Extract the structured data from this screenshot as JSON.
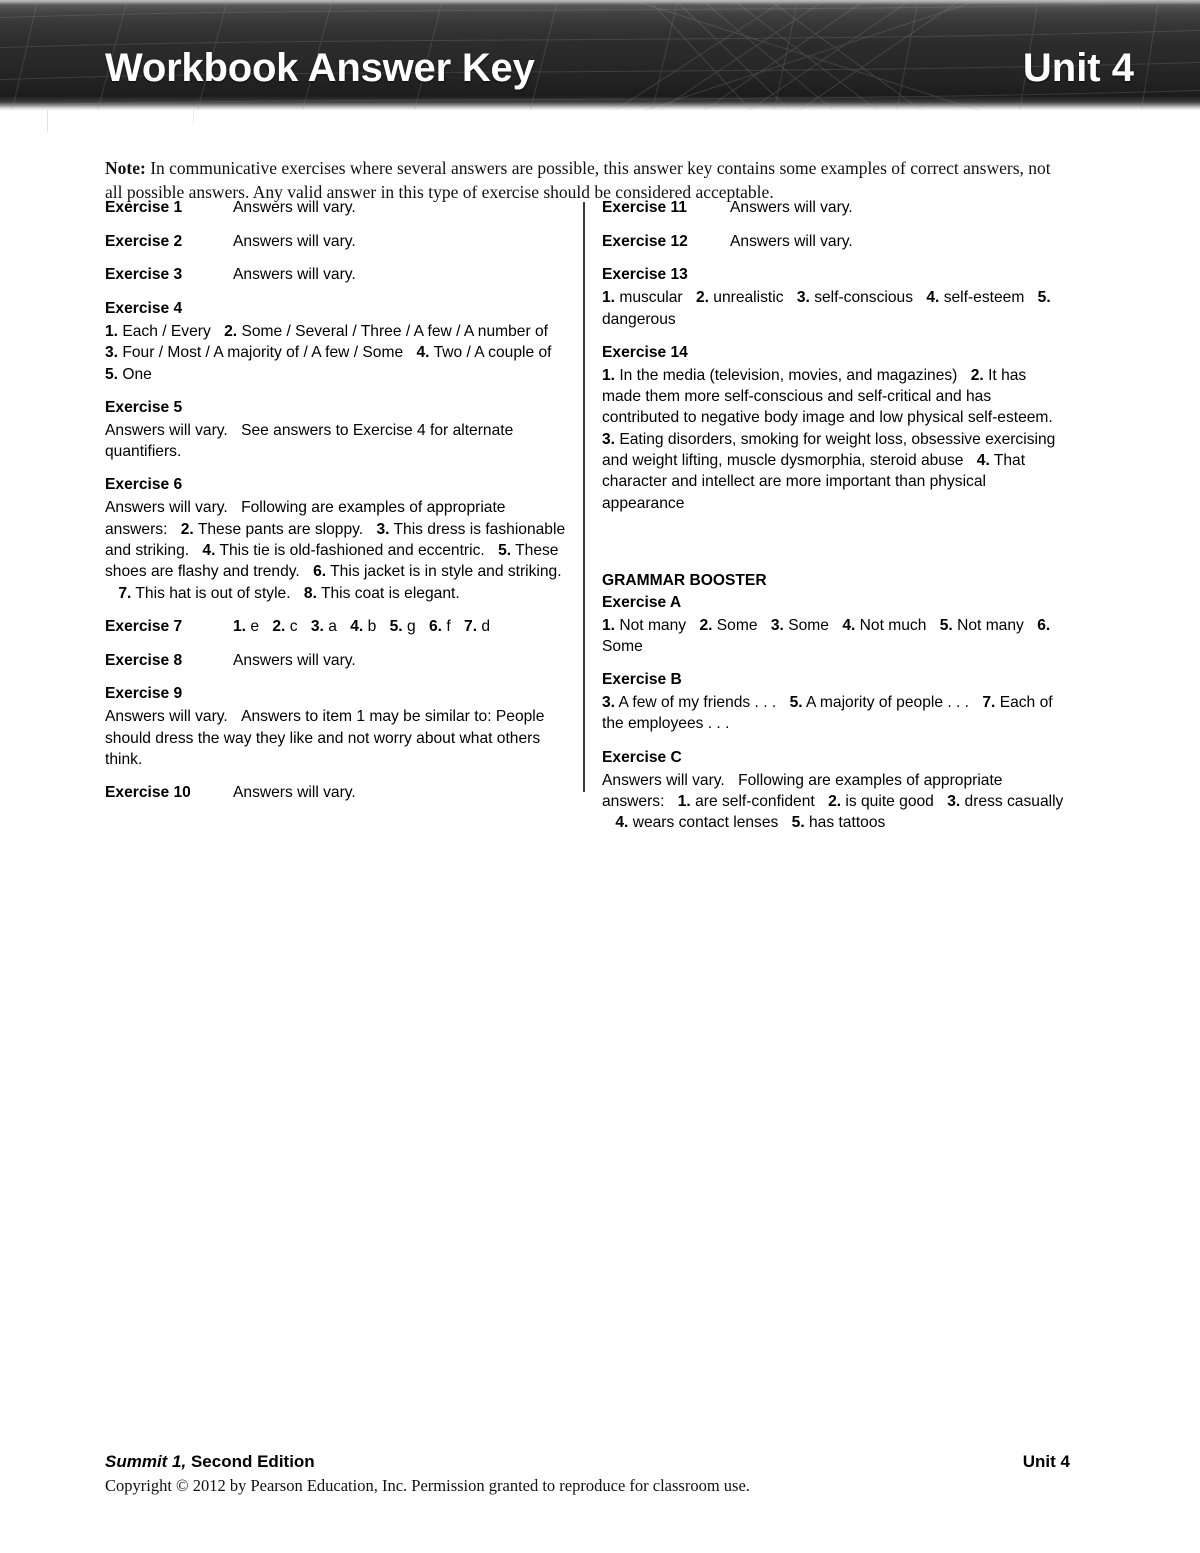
{
  "header": {
    "title": "Workbook Answer Key",
    "unit": "Unit 4",
    "background_color": "#2c2c2c",
    "text_color": "#ffffff"
  },
  "note": {
    "label": "Note:",
    "text": "In communicative exercises where several answers are possible, this answer key contains some examples of correct answers, not all possible answers. Any valid answer in this type of exercise should be considered acceptable."
  },
  "left_column": {
    "exercises": [
      {
        "head": "Exercise 1",
        "layout": "inline",
        "answer": "Answers will vary."
      },
      {
        "head": "Exercise 2",
        "layout": "inline",
        "answer": "Answers will vary."
      },
      {
        "head": "Exercise 3",
        "layout": "inline",
        "answer": "Answers will vary."
      },
      {
        "head": "Exercise 4",
        "layout": "block",
        "body": "1. Each / Every   2. Some / Several / Three / A few / A number of   3. Four / Most / A majority of / A few / Some   4. Two / A couple of   5. One"
      },
      {
        "head": "Exercise 5",
        "layout": "block",
        "body": "Answers will vary.  See answers to Exercise 4 for alternate quantifiers."
      },
      {
        "head": "Exercise 6",
        "layout": "block",
        "body": "Answers will vary.  Following are examples of appropriate answers:   2. These pants are sloppy.   3. This dress is fashionable and striking.   4. This tie is old-fashioned and eccentric.   5. These shoes are flashy and trendy.   6. This jacket is in style and striking.   7. This hat is out of style.   8. This coat is elegant."
      },
      {
        "head": "Exercise 7",
        "layout": "inline",
        "answer": "1. e   2. c   3. a   4. b   5. g   6. f   7. d"
      },
      {
        "head": "Exercise 8",
        "layout": "inline",
        "answer": "Answers will vary."
      },
      {
        "head": "Exercise 9",
        "layout": "block",
        "body": "Answers will vary.  Answers to item 1 may be similar to: People should dress the way they like and not worry about what others think."
      },
      {
        "head": "Exercise 10",
        "layout": "inline",
        "answer": "Answers will vary."
      }
    ]
  },
  "right_column": {
    "exercises": [
      {
        "head": "Exercise 11",
        "layout": "inline",
        "answer": "Answers will vary."
      },
      {
        "head": "Exercise 12",
        "layout": "inline",
        "answer": "Answers will vary."
      },
      {
        "head": "Exercise 13",
        "layout": "block",
        "body": "1. muscular   2. unrealistic   3. self-conscious   4. self-esteem   5. dangerous"
      },
      {
        "head": "Exercise 14",
        "layout": "block",
        "body": "1. In the media (television, movies, and magazines)   2. It has made them more self-conscious and self-critical and has contributed to negative body image and low physical self-esteem.   3. Eating disorders, smoking for weight loss, obsessive exercising and weight lifting, muscle dysmorphia, steroid abuse   4. That character and intellect are more important than physical appearance"
      }
    ],
    "grammar_booster": {
      "section_title": "GRAMMAR BOOSTER",
      "exercises": [
        {
          "head": "Exercise A",
          "layout": "block",
          "body": "1. Not many   2. Some   3. Some   4. Not much   5. Not many   6. Some"
        },
        {
          "head": "Exercise B",
          "layout": "block",
          "body": "3. A few of my friends . . .   5. A majority of people . . .   7. Each of the employees . . ."
        },
        {
          "head": "Exercise C",
          "layout": "block",
          "body": "Answers will vary.  Following are examples of appropriate answers:   1. are self-confident   2. is quite good   3. dress casually   4. wears contact lenses   5. has tattoos"
        }
      ]
    }
  },
  "footer": {
    "book_title": "Summit 1,",
    "edition": " Second Edition",
    "unit": "Unit 4",
    "copyright": "Copyright © 2012 by Pearson Education, Inc. Permission granted to reproduce for classroom use."
  }
}
